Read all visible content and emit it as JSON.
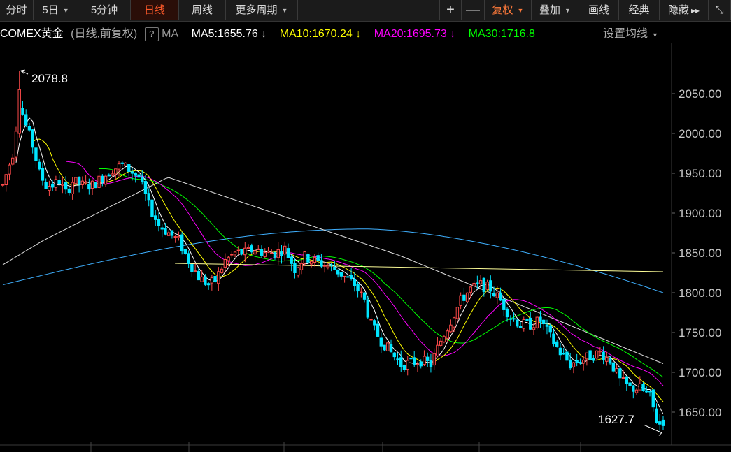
{
  "toolbar": {
    "items": [
      {
        "label": "分时",
        "active": false,
        "caret": false
      },
      {
        "label": "5日",
        "active": false,
        "caret": true
      },
      {
        "label": "5分钟",
        "active": false,
        "caret": false
      },
      {
        "label": "日线",
        "active": true,
        "caret": false
      },
      {
        "label": "周线",
        "active": false,
        "caret": false
      },
      {
        "label": "更多周期",
        "active": false,
        "caret": true
      }
    ],
    "right": [
      {
        "label": "+",
        "name": "zoom-in-button"
      },
      {
        "label": "—",
        "name": "zoom-out-button"
      },
      {
        "label": "复权",
        "name": "adjust-button",
        "caret": true,
        "color": "#ff7a3a"
      },
      {
        "label": "叠加",
        "name": "overlay-button",
        "caret": true
      },
      {
        "label": "画线",
        "name": "draw-line-button"
      },
      {
        "label": "经典",
        "name": "classic-button"
      },
      {
        "label": "隐藏",
        "name": "hide-button",
        "arrows": "▸▸"
      },
      {
        "label": "⤡",
        "name": "fullscreen-icon"
      }
    ]
  },
  "legend": {
    "name": "COMEX黄金",
    "mode": "(日线,前复权)",
    "help": "?",
    "ma_label": "MA",
    "ma5": "MA5:1655.76",
    "ma10": "MA10:1670.24",
    "ma20": "MA20:1695.73",
    "ma30": "MA30:1716.8",
    "arrow": "↓",
    "settings": "设置均线"
  },
  "colors": {
    "up": "#ff4a4a",
    "down": "#00e5ff",
    "ma5": "#ffffff",
    "ma10": "#ffff00",
    "ma20": "#ff00ff",
    "ma30": "#00ff00",
    "ma60": "#e0e0e0",
    "ma120": "#3fb0ff",
    "trend": "#ffff99",
    "accent": "#ff5a2a"
  },
  "axis": {
    "ticks": [
      "2050.00",
      "2000.00",
      "1950.00",
      "1900.00",
      "1850.00",
      "1800.00",
      "1750.00",
      "1700.00",
      "1650.00"
    ]
  },
  "annotations": {
    "high": "2078.8",
    "low": "1627.7"
  },
  "chart_data": {
    "type": "candlestick",
    "y_range": [
      1620,
      2090
    ],
    "high_price": 2078.8,
    "low_price": 1627.7,
    "ma_latest": {
      "MA5": 1655.76,
      "MA10": 1670.24,
      "MA20": 1695.73,
      "MA30": 1716.8
    }
  }
}
